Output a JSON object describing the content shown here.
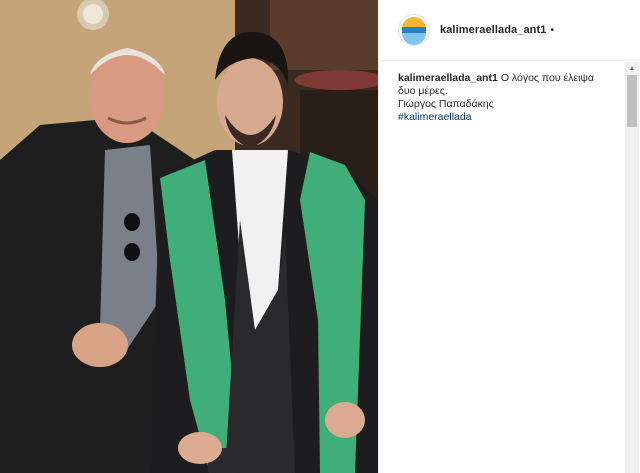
{
  "post": {
    "username": "kalimeraellada_ant1",
    "follow_dot": "•",
    "avatar_label": "καλημέρα ελλάδα",
    "caption": {
      "user": "kalimeraellada_ant1",
      "text_line1": "Ο λόγος που έλειψα δυο μέρες.",
      "text_line2": "Γιώργος Παπαδάκης",
      "hashtag": "#kalimeraellada"
    }
  },
  "colors": {
    "gown_green": "#3fae78",
    "gown_black": "#1d1d1f",
    "link": "#003569"
  },
  "icons": {
    "scroll_up": "scroll-up-arrow-icon"
  }
}
